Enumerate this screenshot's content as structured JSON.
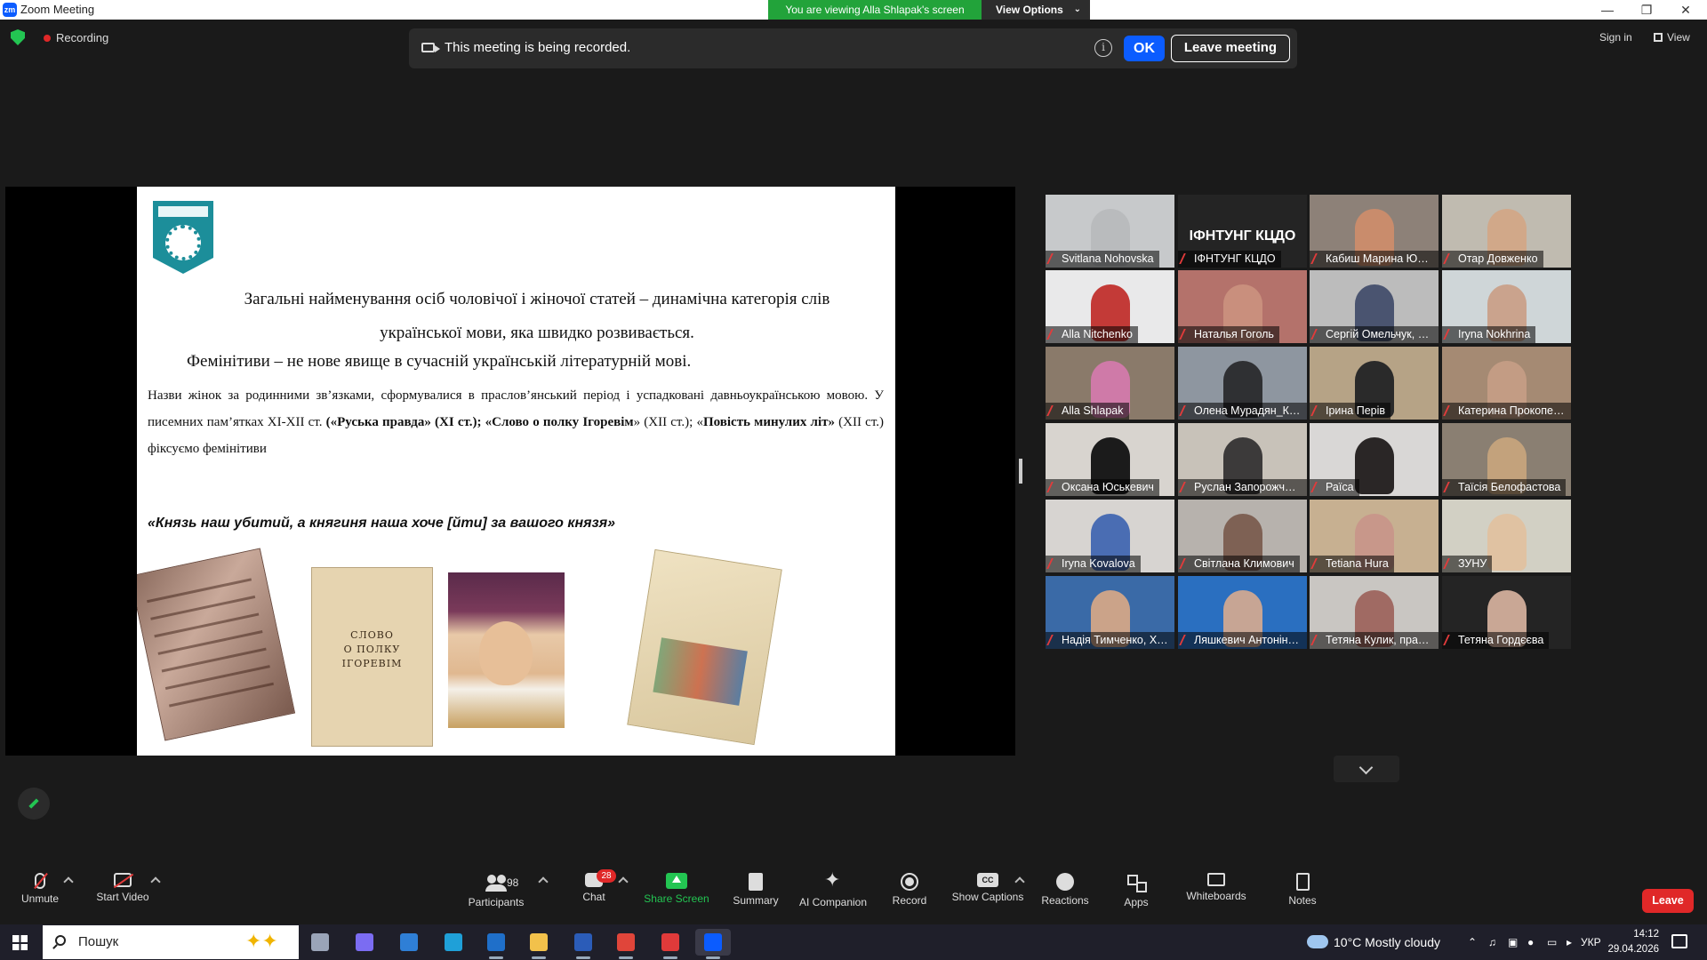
{
  "window": {
    "title": "Zoom Meeting",
    "viewing_banner": "You are viewing Alla Shlapak's screen",
    "view_options": "View Options",
    "controls": {
      "minimize": "—",
      "restore": "❐",
      "close": "✕"
    }
  },
  "top": {
    "recording_label": "Recording",
    "sign_in": "Sign in",
    "view": "View"
  },
  "record_banner": {
    "message": "This meeting is being recorded.",
    "info": "i",
    "ok": "OK",
    "leave": "Leave meeting"
  },
  "slide": {
    "line1": "Загальні найменування осіб чоловічої і жіночої статей – динамічна категорія слів української мови, яка швидко розвивається.",
    "line2": "Фемінітиви – не нове явище в сучасній українській літературній мові.",
    "para_a": "Назви жінок за родинними зв’язками, сформувалися в праслов’янський період і успадковані давньоукраїнською мовою. У писемних пам’ятках ХІ-ХІІ ст. ",
    "para_b": "(«Руська правда» (ХІ ст.); «Слово о полку Ігоревім",
    "para_c": "» (ХІІ ст.); «",
    "para_d": "Повість минулих літ»",
    "para_e": " (ХІІ ст.) фіксуємо фемінітиви",
    "quote": "«Князь наш убитий, а княгиня наша хоче [йти] за вашого князя»",
    "book_text": "СЛОВО\nО ПОЛКУ ІГОРЕВІМ"
  },
  "participants_tiles": [
    {
      "name": "Svitlana Nohovska",
      "bg": "#c7c9cb",
      "skin": "#b9bbbd"
    },
    {
      "name": "ІФНТУНГ КЦДО",
      "bg": "#242424",
      "skin": "",
      "big_text": "ІФНТУНГ КЦДО"
    },
    {
      "name": "Кабиш Марина Юріївна",
      "bg": "#8d8178",
      "skin": "#c98c6c"
    },
    {
      "name": "Отар Довженко",
      "bg": "#c0bbb0",
      "skin": "#d1a889"
    },
    {
      "name": "Alla Nitchenko",
      "bg": "#e9e9ea",
      "skin": "#c33a37"
    },
    {
      "name": "Наталья Гоголь",
      "bg": "#b4726b",
      "skin": "#c98f7d"
    },
    {
      "name": "Сергій Омельчук, ХДУ",
      "bg": "#bcbcbc",
      "skin": "#4a5470"
    },
    {
      "name": "Iryna Nokhrina",
      "bg": "#cfd6d8",
      "skin": "#caa38d"
    },
    {
      "name": "Alla Shlapak",
      "bg": "#8a7a6a",
      "skin": "#cf7aa8"
    },
    {
      "name": "Олена Мурадян_Каразі...",
      "bg": "#8e96a0",
      "skin": "#2f3033"
    },
    {
      "name": "Ірина Перів",
      "bg": "#b6a386",
      "skin": "#2a2a2a"
    },
    {
      "name": "Катерина Прокопенко",
      "bg": "#a58a73",
      "skin": "#c39c84"
    },
    {
      "name": "Оксана Юськевич",
      "bg": "#d8d4cf",
      "skin": "#1b1b1b"
    },
    {
      "name": "Руслан Запорожченко",
      "bg": "#c8c2b9",
      "skin": "#3c3a3a"
    },
    {
      "name": "Раїса",
      "bg": "#d9d7d6",
      "skin": "#2a2626"
    },
    {
      "name": "Таїсія Белофастова",
      "bg": "#8a7f72",
      "skin": "#c3a27c"
    },
    {
      "name": "Iryna Kovalova",
      "bg": "#d7d4d1",
      "skin": "#4a6db3"
    },
    {
      "name": "Світлана Климович",
      "bg": "#b7b2ad",
      "skin": "#7e6154"
    },
    {
      "name": "Tetiana Hura",
      "bg": "#c7b091",
      "skin": "#c8978a"
    },
    {
      "name": "ЗУНУ",
      "bg": "#d2d0c4",
      "skin": "#e0c2a2"
    },
    {
      "name": "Надія Тимченко, ХНТУ",
      "bg": "#3a6aa7",
      "skin": "#cba389"
    },
    {
      "name": "Ляшкевич Антоніна Іва...",
      "bg": "#2a6fc0",
      "skin": "#c7a594"
    },
    {
      "name": "Тетяна Кулик, практичн...",
      "bg": "#c9c6c2",
      "skin": "#a06a63"
    },
    {
      "name": "Тетяна Гордєєва",
      "bg": "#242424",
      "skin": "#c9a795"
    }
  ],
  "toolbar": {
    "unmute": "Unmute",
    "start_video": "Start Video",
    "participants": "Participants",
    "participants_count": "98",
    "chat": "Chat",
    "chat_badge": "28",
    "share_screen": "Share Screen",
    "summary": "Summary",
    "ai_companion": "AI Companion",
    "record": "Record",
    "show_captions": "Show Captions",
    "captions_icon_text": "CC",
    "reactions": "Reactions",
    "apps": "Apps",
    "whiteboards": "Whiteboards",
    "notes": "Notes",
    "leave": "Leave"
  },
  "taskbar": {
    "search_placeholder": "Пошук",
    "weather": "10°C  Mostly cloudy",
    "lang": "УКР",
    "time": "14:12",
    "date": "29.04.2026",
    "apps": [
      {
        "name": "task-view-icon",
        "color": "#9aa4b8"
      },
      {
        "name": "copilot-icon",
        "color": "#7b6cf2"
      },
      {
        "name": "store-icon",
        "color": "#2f7fd6"
      },
      {
        "name": "edge-icon",
        "color": "#1fa0d8"
      },
      {
        "name": "outlook-icon",
        "color": "#1f6fc9"
      },
      {
        "name": "file-explorer-icon",
        "color": "#f2c14b"
      },
      {
        "name": "word-icon",
        "color": "#2b5cb8"
      },
      {
        "name": "chrome-icon",
        "color": "#e0453a"
      },
      {
        "name": "wps-icon",
        "color": "#e03a3a"
      },
      {
        "name": "zoom-taskbar-icon",
        "color": "#0b5cff"
      }
    ]
  }
}
